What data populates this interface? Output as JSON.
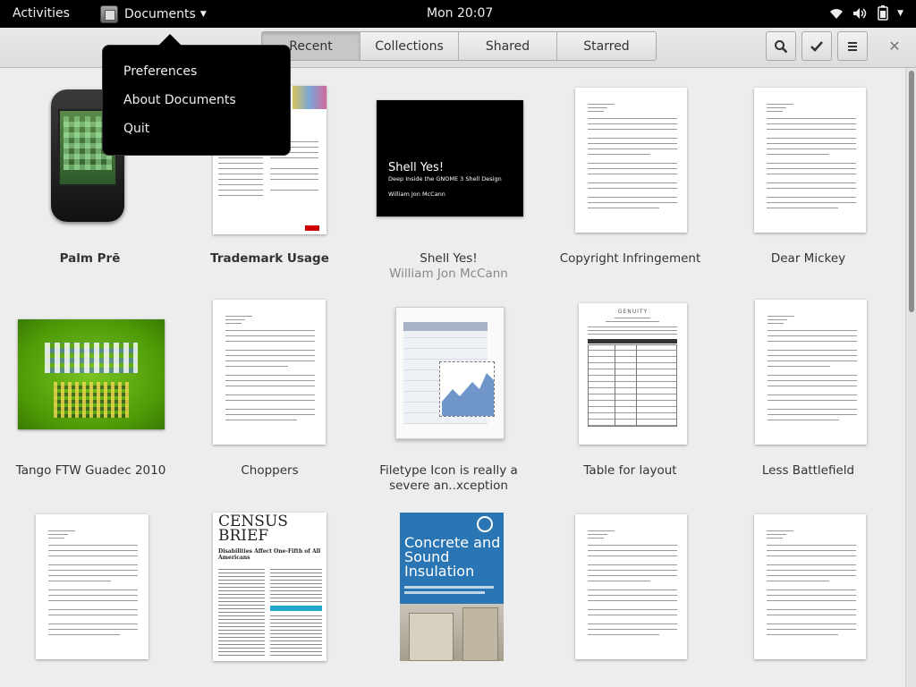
{
  "topbar": {
    "activities": "Activities",
    "app_name": "Documents",
    "clock": "Mon 20:07"
  },
  "tabs": [
    {
      "label": "Recent",
      "active": true
    },
    {
      "label": "Collections",
      "active": false
    },
    {
      "label": "Shared",
      "active": false
    },
    {
      "label": "Starred",
      "active": false
    }
  ],
  "app_menu": {
    "items": [
      "Preferences",
      "About Documents",
      "Quit"
    ]
  },
  "shell_cover": {
    "title": "Shell Yes!",
    "subtitle": "Deep Inside the GNOME 3 Shell Design",
    "author": "William Jon McCann"
  },
  "census_cover": {
    "title1": "CENSUS",
    "title2": "BRIEF",
    "headline": "Disabilities Affect One-Fifth of All Americans"
  },
  "concrete_cover": {
    "title": "Concrete and Sound Insulation"
  },
  "table_doc": {
    "heading": "GENUITY"
  },
  "documents": [
    {
      "title": "Palm Prē",
      "subtitle": "",
      "bold": true
    },
    {
      "title": "Trademark Usage",
      "subtitle": "",
      "bold": true
    },
    {
      "title": "Shell Yes!",
      "subtitle": "William Jon McCann",
      "bold": false
    },
    {
      "title": "Copyright Infringement",
      "subtitle": "",
      "bold": false
    },
    {
      "title": "Dear Mickey",
      "subtitle": "",
      "bold": false
    },
    {
      "title": "Tango FTW Guadec 2010",
      "subtitle": "",
      "bold": false
    },
    {
      "title": "Choppers",
      "subtitle": "",
      "bold": false
    },
    {
      "title": "Filetype Icon is really a severe an..xception",
      "subtitle": "",
      "bold": false
    },
    {
      "title": "Table for layout",
      "subtitle": "",
      "bold": false
    },
    {
      "title": "Less Battlefield",
      "subtitle": "",
      "bold": false
    },
    {
      "title": "",
      "subtitle": "",
      "bold": false
    },
    {
      "title": "",
      "subtitle": "",
      "bold": false
    },
    {
      "title": "",
      "subtitle": "",
      "bold": false
    },
    {
      "title": "",
      "subtitle": "",
      "bold": false
    },
    {
      "title": "",
      "subtitle": "",
      "bold": false
    }
  ],
  "colors": {
    "topbar_bg": "#000000",
    "headerbar": "#e0e0e0",
    "content_bg": "#ededed",
    "tango_green": "#4e9a06",
    "concrete_blue": "#2a75b3"
  }
}
